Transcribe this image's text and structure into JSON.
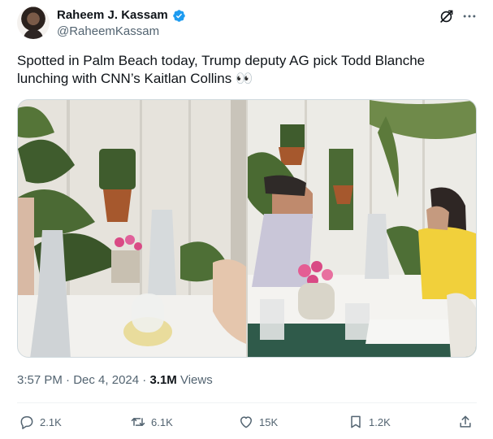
{
  "author": {
    "display_name": "Raheem J. Kassam",
    "handle": "@RaheemKassam",
    "verified": true
  },
  "tweet": {
    "text": "Spotted in Palm Beach today, Trump deputy AG pick Todd Blanche lunching with CNN’s Kaitlan Collins 👀"
  },
  "meta": {
    "time": "3:57 PM",
    "separator": "·",
    "date": "Dec 4, 2024",
    "views_count": "3.1M",
    "views_label": "Views"
  },
  "actions": {
    "replies": "2.1K",
    "reposts": "6.1K",
    "likes": "15K",
    "bookmarks": "1.2K"
  },
  "colors": {
    "verified": "#1d9bf0",
    "text": "#0f1419",
    "secondary": "#536471"
  },
  "icons": [
    "grok-icon",
    "more-icon",
    "reply-icon",
    "repost-icon",
    "like-icon",
    "bookmark-icon",
    "share-icon",
    "verified-icon"
  ]
}
